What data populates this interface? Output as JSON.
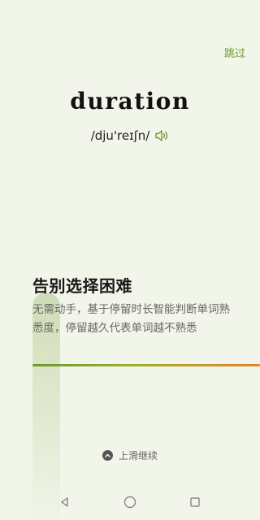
{
  "header": {
    "skip_label": "跳过"
  },
  "word": {
    "text": "duration",
    "phonetic": "/dju'reɪʃn/",
    "speaker_icon": "speaker-icon"
  },
  "intro": {
    "headline": "告别选择困难",
    "description": "无需动手，基于停留时长智能判断单词熟悉度，停留越久代表单词越不熟悉"
  },
  "footer": {
    "swipe_label": "上滑继续",
    "swipe_icon": "chevron-up-icon"
  },
  "navigation": {
    "buttons": [
      "back-icon",
      "home-icon",
      "recents-icon"
    ]
  },
  "colors": {
    "background": "#f2f5ea",
    "accent_green": "#6f9a2a",
    "accent_orange": "#e4822a"
  }
}
